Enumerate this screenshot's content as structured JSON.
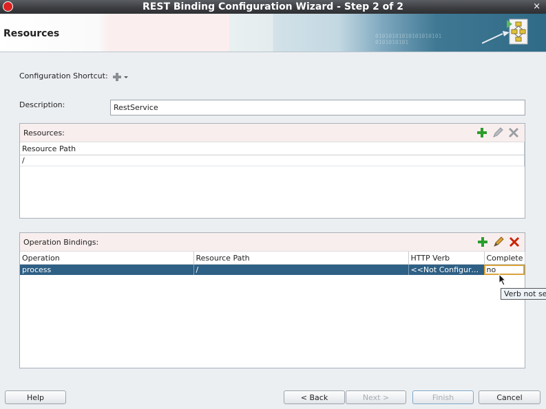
{
  "window": {
    "title": "REST Binding Configuration Wizard - Step 2 of 2",
    "close_glyph": "×"
  },
  "banner": {
    "title": "Resources",
    "binary_text": "01010101010101010101\n0101010101"
  },
  "form": {
    "config_shortcut_label": "Configuration Shortcut:",
    "description_label": "Description:",
    "description_value": "RestService"
  },
  "resources_panel": {
    "title": "Resources:",
    "columns": [
      "Resource Path"
    ],
    "rows": [
      [
        "/"
      ]
    ]
  },
  "operations_panel": {
    "title": "Operation Bindings:",
    "columns": [
      "Operation",
      "Resource Path",
      "HTTP Verb",
      "Complete"
    ],
    "rows": [
      [
        "process",
        "/",
        "<<Not Configure...",
        "no"
      ]
    ]
  },
  "tooltip": "Verb not sel",
  "buttons": {
    "help": "Help",
    "back": "< Back",
    "next": "Next >",
    "finish": "Finish",
    "cancel": "Cancel"
  },
  "colors": {
    "selection": "#2e5f84",
    "add_icon": "#2a9d2a",
    "delete_icon": "#cc2200"
  }
}
